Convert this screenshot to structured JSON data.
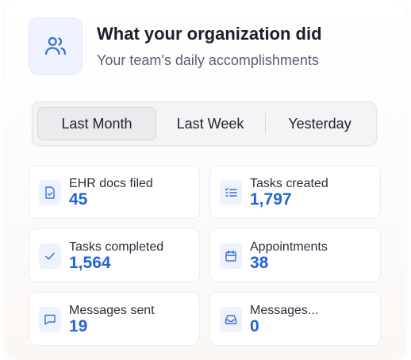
{
  "header": {
    "title": "What your organization did",
    "subtitle": "Your team's daily accomplishments",
    "icon": "users-icon"
  },
  "periods": {
    "items": [
      "Last Month",
      "Last Week",
      "Yesterday"
    ],
    "selected": "Last Month"
  },
  "stats": [
    {
      "label": "EHR docs filed",
      "value": "45",
      "icon": "document-check-icon"
    },
    {
      "label": "Tasks created",
      "value": "1,797",
      "icon": "list-icon"
    },
    {
      "label": "Tasks completed",
      "value": "1,564",
      "icon": "check-icon"
    },
    {
      "label": "Appointments",
      "value": "38",
      "icon": "calendar-icon"
    },
    {
      "label": "Messages sent",
      "value": "19",
      "icon": "message-icon"
    },
    {
      "label": "Messages...",
      "value": "0",
      "icon": "inbox-icon"
    }
  ],
  "colors": {
    "accent": "#2364d2",
    "icon_bg": "#eef2fd"
  }
}
